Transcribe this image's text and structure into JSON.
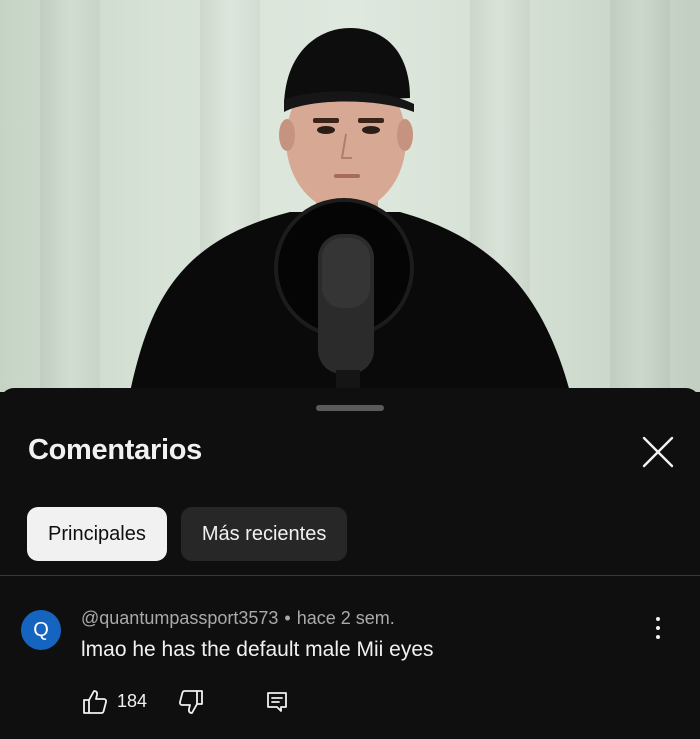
{
  "video": {
    "description_icon": "person-with-microphone-video-frame"
  },
  "sheet": {
    "title": "Comentarios",
    "close_icon": "close-icon",
    "chips": [
      {
        "label": "Principales",
        "selected": true
      },
      {
        "label": "Más recientes",
        "selected": false
      }
    ]
  },
  "comment": {
    "avatar_letter": "Q",
    "avatar_color": "#1565c0",
    "author": "@quantumpassport3573",
    "separator": "•",
    "time": "hace 2 sem.",
    "text": "lmao he has the default male Mii eyes",
    "likes": "184"
  },
  "colors": {
    "background": "#0f0f0f",
    "chip_active_bg": "#f1f1f1",
    "chip_inactive_bg": "#272727",
    "secondary_text": "#aaaaaa"
  }
}
